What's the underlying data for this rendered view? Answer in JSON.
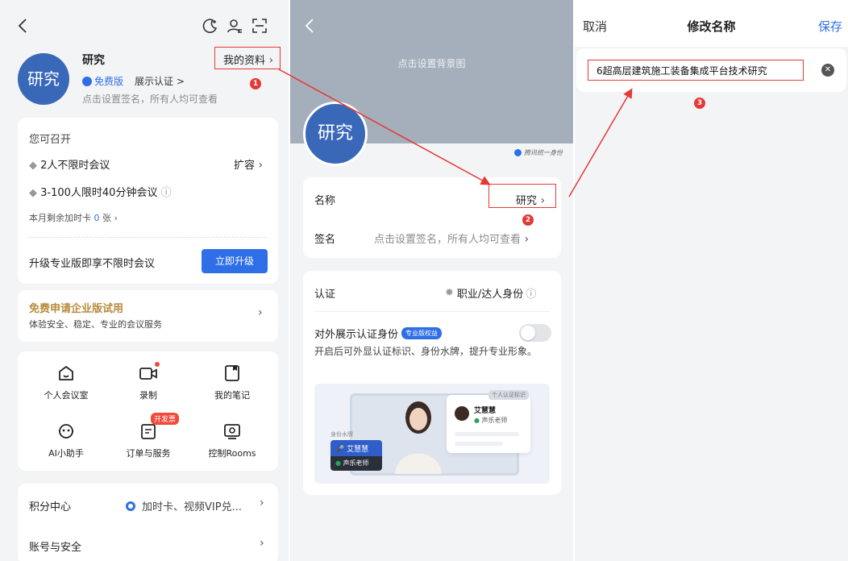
{
  "p1": {
    "avatar_text": "研究",
    "user_name": "研究",
    "edition": "免费版",
    "show_cert": "展示认证 >",
    "signature_hint": "点击设置签名，所有人均可查看",
    "my_profile": "我的资料",
    "annotation_1": "1",
    "can_host": "您可召开",
    "feature_1": "2人不限时会议",
    "expand": "扩容",
    "feature_2": "3-100人限时40分钟会议",
    "card_prefix": "本月剩余加时卡",
    "card_count": "0",
    "card_suffix": "张",
    "upgrade_text": "升级专业版即享不限时会议",
    "upgrade_button": "立即升级",
    "enterprise_title": "免费申请企业版试用",
    "enterprise_sub": "体验安全、稳定、专业的会议服务",
    "grid": [
      {
        "label": "个人会议室",
        "icon": "meeting-room-icon"
      },
      {
        "label": "录制",
        "icon": "record-icon"
      },
      {
        "label": "我的笔记",
        "icon": "notes-icon"
      },
      {
        "label": "AI小助手",
        "icon": "ai-assistant-icon"
      },
      {
        "label": "订单与服务",
        "icon": "orders-icon"
      },
      {
        "label": "控制Rooms",
        "icon": "rooms-icon"
      }
    ],
    "invoice_badge": "开发票",
    "points_label": "积分中心",
    "points_value": "加时卡、视频VIP兑...",
    "account_label": "账号与安全"
  },
  "p2": {
    "bg_hint": "点击设置背景图",
    "avatar_text": "研究",
    "tencent_id": "腾讯统一身份",
    "name_label": "名称",
    "name_value": "研究",
    "annotation_2": "2",
    "sig_label": "签名",
    "sig_value": "点击设置签名，所有人均可查看",
    "cert_label": "认证",
    "cert_value": "职业/达人身份",
    "show_cert_label": "对外展示认证身份",
    "pro_badge": "专业版权益",
    "show_cert_desc": "开启后可外显认证标识、身份水牌，提升专业形象。",
    "preview_card_tag": "个人认证标识",
    "preview_name": "艾慧慧",
    "preview_role": "声乐老师",
    "preview_tag_label": "身份水牌"
  },
  "p3": {
    "cancel": "取消",
    "title": "修改名称",
    "save": "保存",
    "input_value": "6超高层建筑施工装备集成平台技术研究",
    "annotation_3": "3"
  },
  "colors": {
    "accent": "#2e6fe8",
    "annotation": "#e53935",
    "gold": "#b88a3b"
  }
}
